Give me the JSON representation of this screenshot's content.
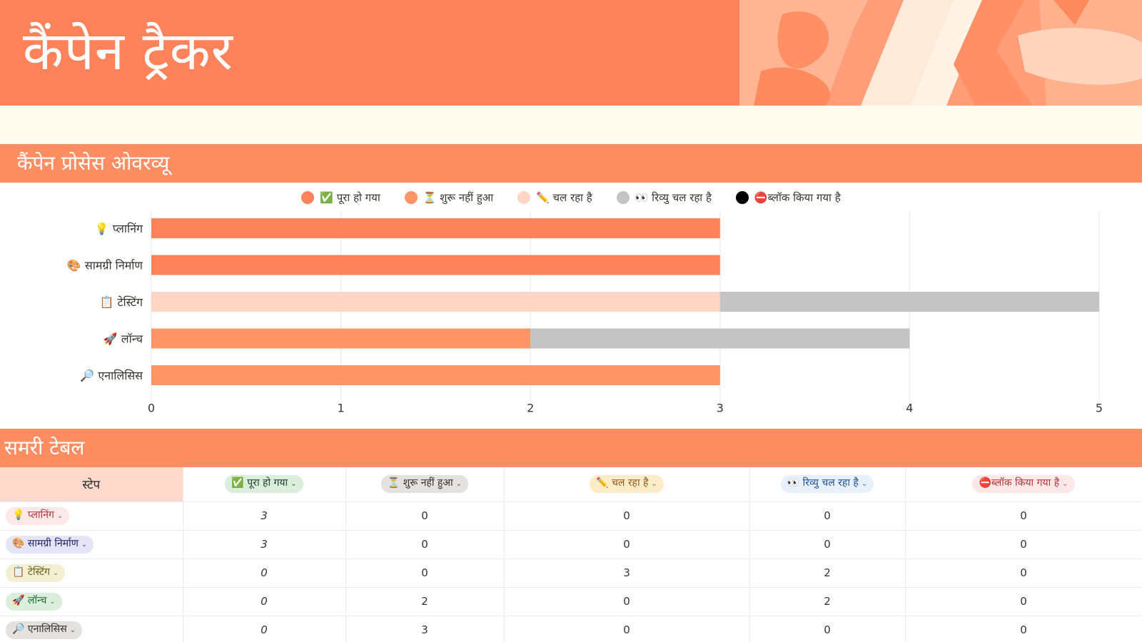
{
  "page": {
    "title": "कैंपेन ट्रैकर",
    "section_chart": "कैंपेन प्रोसेस ओवरव्यू",
    "section_table": "समरी टेबल"
  },
  "colors": {
    "banner": "#ff825a",
    "section": "#ff8d62",
    "cream": "#fffbee",
    "done": "#ff825a",
    "not_started": "#ff9466",
    "in_progress": "#ffd6c6",
    "review": "#c4c4c4",
    "blocked": "#000000"
  },
  "legend": [
    {
      "label": "✅ पूरा हो गया",
      "color": "#ff825a"
    },
    {
      "label": "⏳ शुरू नहीं हुआ",
      "color": "#ff9466"
    },
    {
      "label": "✏️ चल रहा है",
      "color": "#ffd6c6"
    },
    {
      "label": "👀 रिव्यु चल रहा है",
      "color": "#c4c4c4"
    },
    {
      "label": "⛔ब्लॉक किया गया है",
      "color": "#000000"
    }
  ],
  "chart_data": {
    "type": "bar",
    "orientation": "horizontal",
    "stacked": true,
    "categories": [
      "💡 प्लानिंग",
      "🎨 सामग्री निर्माण",
      "📋 टेस्टिंग",
      "🚀 लॉन्च",
      "🔎 एनालिसिस"
    ],
    "series": [
      {
        "name": "✅ पूरा हो गया",
        "color": "#ff825a",
        "values": [
          3,
          3,
          0,
          0,
          0
        ]
      },
      {
        "name": "⏳ शुरू नहीं हुआ",
        "color": "#ff9466",
        "values": [
          0,
          0,
          0,
          2,
          3
        ]
      },
      {
        "name": "✏️ चल रहा है",
        "color": "#ffd6c6",
        "values": [
          0,
          0,
          3,
          0,
          0
        ]
      },
      {
        "name": "👀 रिव्यु चल रहा है",
        "color": "#c4c4c4",
        "values": [
          0,
          0,
          2,
          2,
          0
        ]
      },
      {
        "name": "⛔ब्लॉक किया गया है",
        "color": "#000000",
        "values": [
          0,
          0,
          0,
          0,
          0
        ]
      }
    ],
    "xlim": [
      0,
      5
    ],
    "xticks": [
      0,
      1,
      2,
      3,
      4,
      5
    ],
    "grid": true,
    "legend": "top-center"
  },
  "table": {
    "step_header": "स्टेप",
    "columns": [
      {
        "label": "✅ पूरा हो गया",
        "bg": "#dbeddb",
        "fg": "#1c3829"
      },
      {
        "label": "⏳ शुरू नहीं हुआ",
        "bg": "#e3e2e0",
        "fg": "#32302c"
      },
      {
        "label": "✏️ चल रहा है",
        "bg": "#fdecc8",
        "fg": "#8a5a1c"
      },
      {
        "label": "👀 रिव्यु चल रहा है",
        "bg": "#e7f0fb",
        "fg": "#1f4f8f"
      },
      {
        "label": "⛔ब्लॉक किया गया है",
        "bg": "#fde8e8",
        "fg": "#b0353a"
      }
    ],
    "rows": [
      {
        "step": "💡 प्लानिंग",
        "bg": "#fde8e8",
        "fg": "#b0353a",
        "values": [
          "3",
          "0",
          "0",
          "0",
          "0"
        ]
      },
      {
        "step": "🎨 सामग्री निर्माण",
        "bg": "#e6e4f7",
        "fg": "#1f1f6e",
        "values": [
          "3",
          "0",
          "0",
          "0",
          "0"
        ]
      },
      {
        "step": "📋 टेस्टिंग",
        "bg": "#f3efd3",
        "fg": "#6a5a16",
        "values": [
          "0",
          "0",
          "3",
          "2",
          "0"
        ]
      },
      {
        "step": "🚀 लॉन्च",
        "bg": "#dbeddb",
        "fg": "#1e6b35",
        "values": [
          "0",
          "2",
          "0",
          "2",
          "0"
        ]
      },
      {
        "step": "🔎 एनालिसिस",
        "bg": "#e3e2e0",
        "fg": "#32302c",
        "values": [
          "0",
          "3",
          "0",
          "0",
          "0"
        ]
      }
    ]
  }
}
